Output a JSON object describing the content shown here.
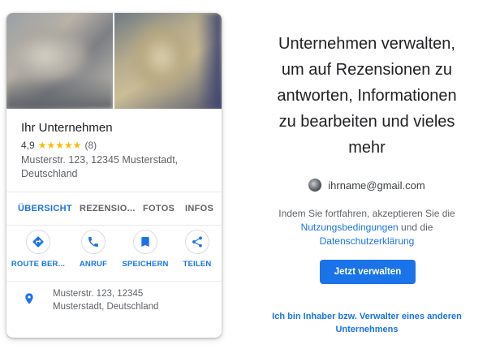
{
  "business": {
    "name": "Ihr Unternehmen",
    "rating": "4,9",
    "stars": "★★★★★",
    "review_count": "(8)",
    "address_line1": "Musterstr. 123, 12345 Musterstadt,",
    "address_line2": "Deutschland"
  },
  "tabs": [
    {
      "label": "ÜBERSICHT",
      "active": true
    },
    {
      "label": "REZENSIO...",
      "active": false
    },
    {
      "label": "FOTOS",
      "active": false
    },
    {
      "label": "INFOS",
      "active": false
    }
  ],
  "actions": [
    {
      "label": "ROUTE BER...",
      "icon": "directions-icon"
    },
    {
      "label": "ANRUF",
      "icon": "phone-icon"
    },
    {
      "label": "SPEICHERN",
      "icon": "bookmark-icon"
    },
    {
      "label": "TEILEN",
      "icon": "share-icon"
    }
  ],
  "address_row": {
    "icon": "location-pin-icon",
    "line1": "Musterstr. 123, 12345",
    "line2": "Musterstadt, Deutschland"
  },
  "panel": {
    "headline_lines": [
      "Unternehmen verwalten,",
      "um auf Rezensionen zu",
      "antworten, Informationen",
      "zu bearbeiten und vieles",
      "mehr"
    ],
    "email": "ihrname@gmail.com",
    "consent_prefix": "Indem Sie fortfahren, akzeptieren Sie die",
    "terms_link": "Nutzungsbedingungen",
    "consent_and": " und die",
    "privacy_link": "Datenschutzerklärung",
    "manage_button": "Jetzt verwalten",
    "owner_link_line1": "Ich bin Inhaber bzw. Verwalter eines anderen",
    "owner_link_line2": "Unternehmens"
  },
  "colors": {
    "accent": "#1a73e8",
    "star": "#fbbc04",
    "text_primary": "#202124",
    "text_secondary": "#5f6368"
  }
}
